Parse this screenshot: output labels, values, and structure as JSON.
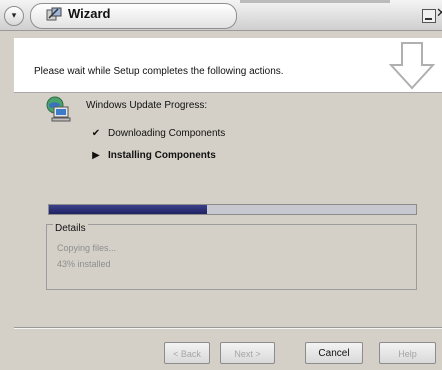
{
  "window": {
    "title": "Wizard",
    "menu_glyph": "▾",
    "close_glyph": "✕"
  },
  "header": {
    "instruction": "Please wait while Setup completes the following actions."
  },
  "progress": {
    "heading": "Windows Update Progress:",
    "steps": [
      {
        "mark": "✔",
        "label": "Downloading Components",
        "status": "done"
      },
      {
        "mark": "▶",
        "label": "Installing Components",
        "status": "current"
      }
    ],
    "fraction": 0.43
  },
  "details": {
    "legend": "Details",
    "line1": "Copying files...",
    "line2": "43% installed"
  },
  "buttons": {
    "back": "< Back",
    "next": "Next >",
    "cancel": "Cancel",
    "help": "Help"
  },
  "colors": {
    "progress_fill": "#2a2c74",
    "disabled_text": "#a5a5a5"
  },
  "icons": {
    "title": "wizard-icon",
    "header": "down-arrow-icon",
    "status": "globe-computer-icon"
  }
}
